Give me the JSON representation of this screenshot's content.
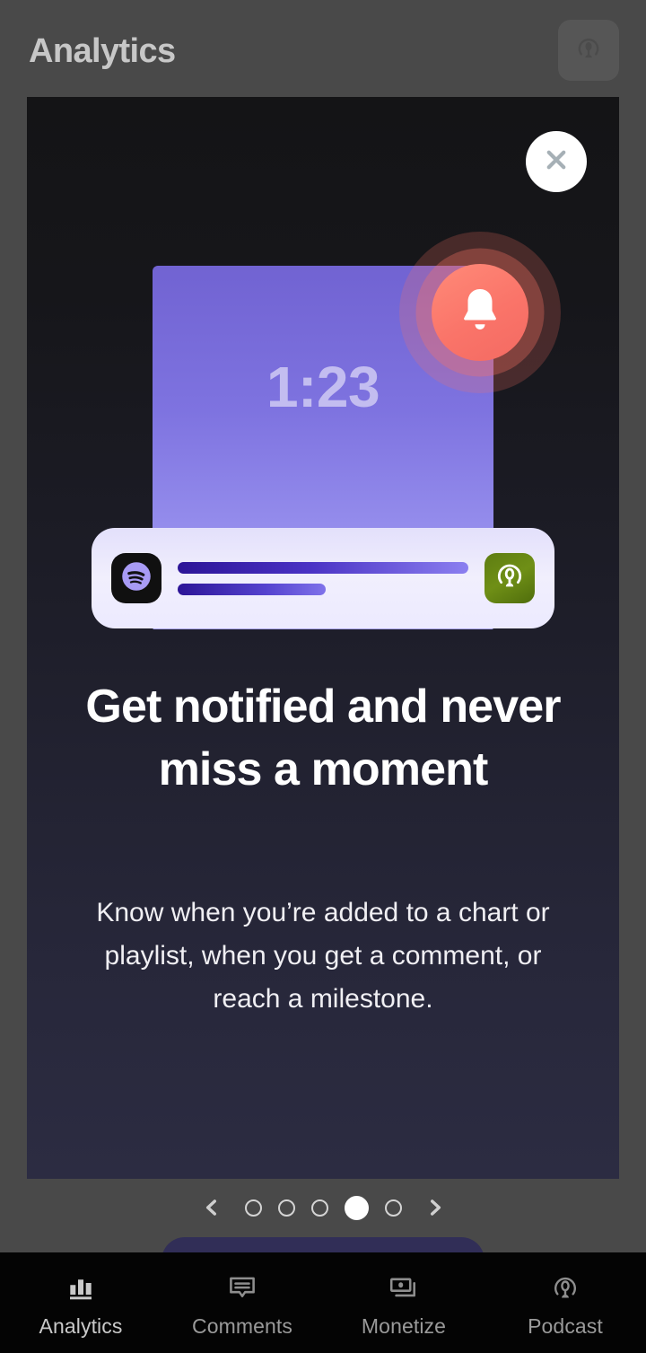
{
  "header": {
    "title": "Analytics",
    "podcast_button_icon": "broadcast-mic-icon"
  },
  "modal": {
    "close_icon": "close-icon",
    "illustration": {
      "time_label": "1:23",
      "bell_icon": "bell-icon",
      "spotify_icon": "spotify-logo-icon",
      "podcaster_icon": "broadcast-mic-icon"
    },
    "headline": "Get notified and never miss a moment",
    "body": "Know when you’re added to a chart or playlist, when you get a comment, or reach a milestone.",
    "pager": {
      "prev_icon": "chevron-left-icon",
      "next_icon": "chevron-right-icon",
      "total_dots": 5,
      "active_index": 4
    }
  },
  "bottom_nav": {
    "items": [
      {
        "label": "Analytics",
        "icon": "bar-chart-icon",
        "active": true
      },
      {
        "label": "Comments",
        "icon": "speech-bubble-icon",
        "active": false
      },
      {
        "label": "Monetize",
        "icon": "banknotes-icon",
        "active": false
      },
      {
        "label": "Podcast",
        "icon": "broadcast-mic-icon",
        "active": false
      }
    ]
  },
  "colors": {
    "accent_purple": "#7e73e0",
    "bell_coral": "#fa7469",
    "podcaster_green": "#6f8f16",
    "modal_top": "#141416",
    "modal_bottom": "#2c2c42",
    "nav_background": "#040404",
    "scrim": "rgba(135,135,135,0.47)"
  }
}
